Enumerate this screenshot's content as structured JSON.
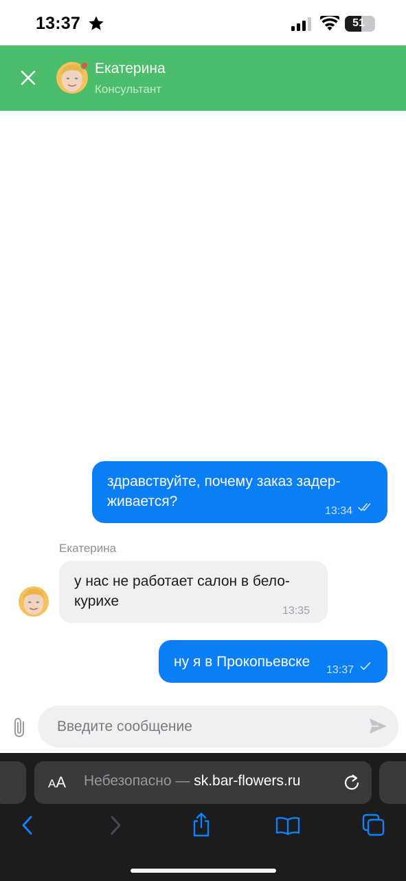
{
  "status_bar": {
    "time": "13:37",
    "battery_level": "51",
    "battery_fraction": 0.51
  },
  "chat_header": {
    "agent_name": "Екатерина",
    "agent_role": "Консультант",
    "accent_color": "#4cbd6a"
  },
  "messages": [
    {
      "direction": "outgoing",
      "lines": [
        "здравствуйте, почему заказ задер-",
        "живается?"
      ],
      "time": "13:34",
      "status": "read"
    },
    {
      "direction": "incoming",
      "sender": "Екатерина",
      "lines": [
        "у нас не работает салон в бело-",
        "курихе"
      ],
      "time": "13:35"
    },
    {
      "direction": "outgoing",
      "lines": [
        "ну я в Прокопьевске"
      ],
      "time": "13:37",
      "status": "sent"
    }
  ],
  "composer": {
    "placeholder": "Введите сообщение",
    "value": ""
  },
  "safari": {
    "aa_small": "A",
    "aa_big": "A",
    "url_prefix": "Небезопасно — ",
    "url_domain": "sk.bar-flowers.ru",
    "accent_color": "#0a84ff"
  },
  "icons": [
    "star-icon",
    "signal-icon",
    "wifi-icon",
    "close-icon",
    "double-check-icon",
    "check-icon",
    "paperclip-icon",
    "send-icon",
    "reload-icon",
    "back-icon",
    "forward-icon",
    "share-icon",
    "bookmarks-icon",
    "tabs-icon"
  ]
}
